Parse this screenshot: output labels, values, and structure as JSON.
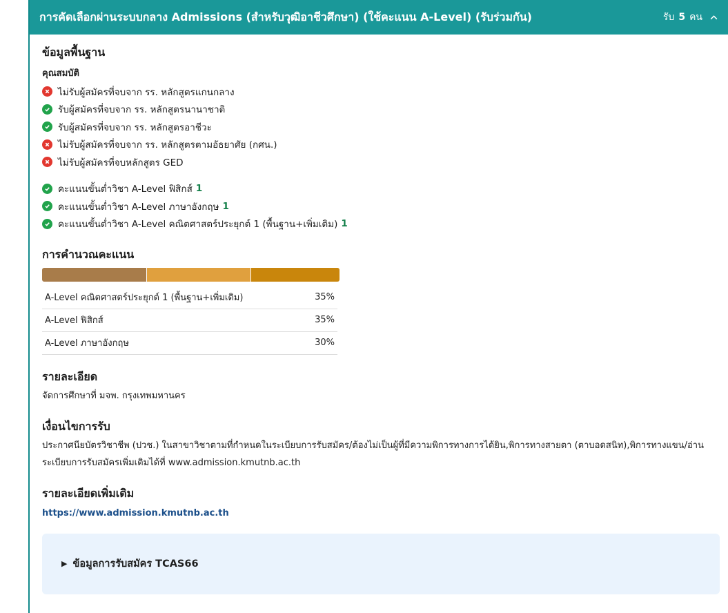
{
  "header": {
    "title": "การคัดเลือกผ่านระบบกลาง Admissions (สำหรับวุฒิอาชีวศึกษา) (ใช้คะแนน A-Level) (รับร่วมกัน)",
    "seats_prefix": "รับ",
    "seats_count": "5",
    "seats_unit": "คน",
    "toggle_icon": "chevron-up-icon"
  },
  "basic_info": {
    "heading": "ข้อมูลพื้นฐาน",
    "qualification_heading": "คุณสมบัติ",
    "qualifications": [
      {
        "status": "no",
        "text": "ไม่รับผู้สมัครที่จบจาก รร. หลักสูตรแกนกลาง"
      },
      {
        "status": "ok",
        "text": "รับผู้สมัครที่จบจาก รร. หลักสูตรนานาชาติ"
      },
      {
        "status": "ok",
        "text": "รับผู้สมัครที่จบจาก รร. หลักสูตรอาชีวะ"
      },
      {
        "status": "no",
        "text": "ไม่รับผู้สมัครที่จบจาก รร. หลักสูตรตามอัธยาศัย (กศน.)"
      },
      {
        "status": "no",
        "text": "ไม่รับผู้สมัครที่จบหลักสูตร GED"
      }
    ],
    "min_scores": [
      {
        "text": "คะแนนขั้นต่ำวิชา A-Level ฟิสิกส์",
        "value": "1"
      },
      {
        "text": "คะแนนขั้นต่ำวิชา A-Level ภาษาอังกฤษ",
        "value": "1"
      },
      {
        "text": "คะแนนขั้นต่ำวิชา A-Level คณิตศาสตร์ประยุกต์ 1 (พื้นฐาน+เพิ่มเติม)",
        "value": "1"
      }
    ]
  },
  "scoring": {
    "heading": "การคำนวณคะแนน",
    "weights": [
      {
        "subject": "A-Level คณิตศาสตร์ประยุกต์ 1 (พื้นฐาน+เพิ่มเติม)",
        "percent": "35%",
        "fraction": 0.35,
        "color": "#a87c4a"
      },
      {
        "subject": "A-Level ฟิสิกส์",
        "percent": "35%",
        "fraction": 0.35,
        "color": "#e0a03e"
      },
      {
        "subject": "A-Level ภาษาอังกฤษ",
        "percent": "30%",
        "fraction": 0.3,
        "color": "#c9860c"
      }
    ]
  },
  "details": {
    "heading": "รายละเอียด",
    "text": "จัดการศึกษาที่ มจพ. กรุงเทพมหานคร"
  },
  "conditions": {
    "heading": "เงื่อนไขการรับ",
    "text": "ประกาศนียบัตรวิชาชีพ (ปวช.) ในสาขาวิชาตามที่กำหนดในระเบียบการรับสมัคร/ต้องไม่เป็นผู้ที่มีความพิการทางการได้ยิน,พิการทางสายตา (ตาบอดสนิท),พิการทางแขน/อ่านระเบียบการรับสมัครเพิ่มเติมได้ที่ www.admission.kmutnb.ac.th"
  },
  "more_details": {
    "heading": "รายละเอียดเพิ่มเติม",
    "link": "https://www.admission.kmutnb.ac.th"
  },
  "tcas": {
    "label": "ข้อมูลการรับสมัคร TCAS66"
  },
  "colors": {
    "header_bg": "#1a9899",
    "ok": "#21a34b",
    "no": "#e2372f",
    "score_value": "#14804a",
    "link": "#1b4f8a",
    "tcas_bg": "#eaf3fd"
  }
}
